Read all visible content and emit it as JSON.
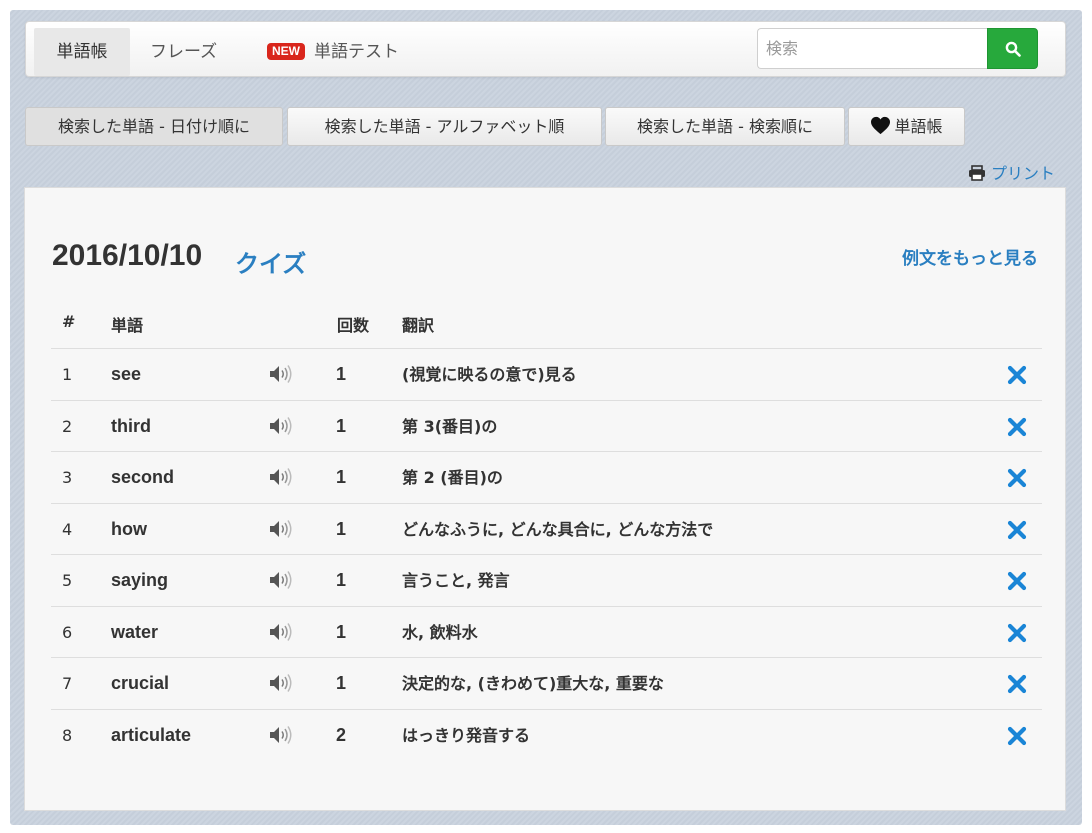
{
  "nav": {
    "tabs": [
      {
        "label": "単語帳"
      },
      {
        "label": "フレーズ"
      },
      {
        "label": "単語テスト",
        "badge": "NEW"
      }
    ],
    "search_placeholder": "検索",
    "search_icon": "search-icon"
  },
  "filters": [
    {
      "label": "検索した単語 - 日付け順に"
    },
    {
      "label": "検索した単語 - アルファベット順"
    },
    {
      "label": "検索した単語 - 検索順に"
    },
    {
      "label": "単語帳",
      "icon": "heart-icon"
    }
  ],
  "print": {
    "label": "プリント",
    "icon": "printer-icon"
  },
  "panel": {
    "date": "2016/10/10",
    "quiz_link": "クイズ",
    "more_examples": "例文をもっと見る",
    "headers": {
      "num": "#",
      "word": "単語",
      "count": "回数",
      "translation": "翻訳"
    },
    "rows": [
      {
        "num": "1",
        "word": "see",
        "count": "1",
        "translation": "(視覚に映るの意で)見る"
      },
      {
        "num": "2",
        "word": "third",
        "count": "1",
        "translation": "第 3(番目)の"
      },
      {
        "num": "3",
        "word": "second",
        "count": "1",
        "translation": "第 2 (番目)の"
      },
      {
        "num": "4",
        "word": "how",
        "count": "1",
        "translation": "どんなふうに, どんな具合に, どんな方法で"
      },
      {
        "num": "5",
        "word": "saying",
        "count": "1",
        "translation": "言うこと, 発言"
      },
      {
        "num": "6",
        "word": "water",
        "count": "1",
        "translation": "水, 飲料水"
      },
      {
        "num": "7",
        "word": "crucial",
        "count": "1",
        "translation": "決定的な, (きわめて)重大な, 重要な"
      },
      {
        "num": "8",
        "word": "articulate",
        "count": "2",
        "translation": "はっきり発音する"
      }
    ]
  },
  "colors": {
    "accent": "#2a7fc1",
    "search_button": "#27a93c",
    "new_badge": "#d9261c"
  }
}
